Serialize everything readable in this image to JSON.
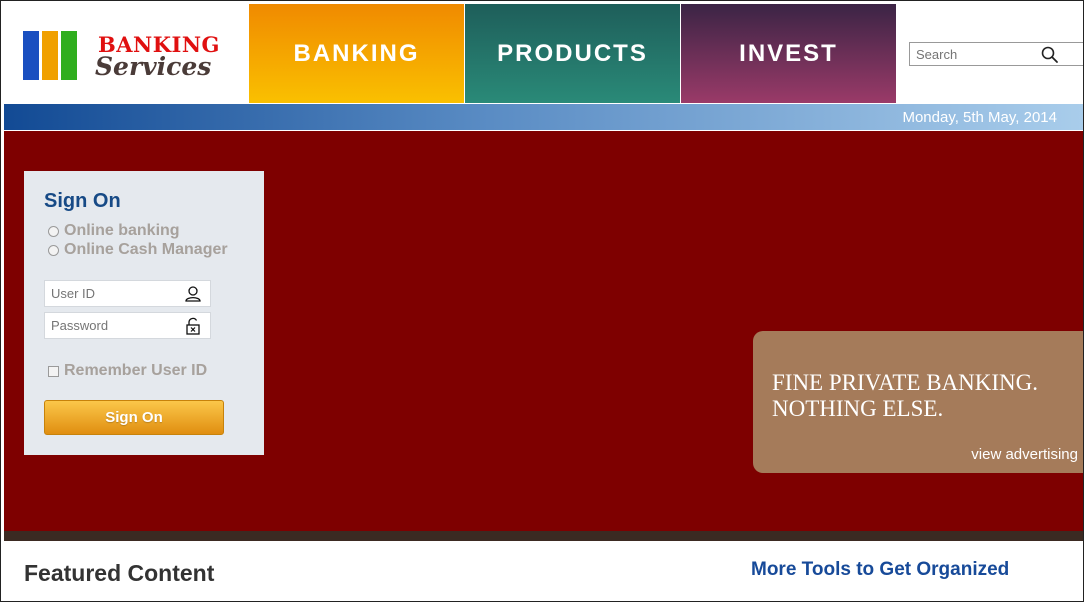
{
  "brand": {
    "line1": "BANKING",
    "line2": "Services",
    "colors": {
      "blue": "#1a4fc0",
      "orange": "#f0a000",
      "green": "#2fae1e",
      "red": "#e01010"
    }
  },
  "nav": {
    "items": [
      {
        "label": "BANKING"
      },
      {
        "label": "PRODUCTS"
      },
      {
        "label": "INVEST"
      }
    ]
  },
  "search": {
    "placeholder": "Search",
    "icon": "search-icon"
  },
  "datebar": {
    "date": "Monday, 5th May, 2014"
  },
  "signon": {
    "title": "Sign On",
    "options": [
      {
        "label": "Online banking"
      },
      {
        "label": "Online Cash Manager"
      }
    ],
    "user_id_placeholder": "User ID",
    "user_icon": "user-icon",
    "password_placeholder": "Password",
    "lock_icon": "unlock-icon",
    "remember_label": "Remember User ID",
    "button_label": "Sign On"
  },
  "ad": {
    "line1": "FINE PRIVATE BANKING.",
    "line2": "NOTHING ELSE.",
    "link": "view advertising"
  },
  "sections": {
    "featured": "Featured Content",
    "more_tools": "More Tools to Get Organized"
  }
}
